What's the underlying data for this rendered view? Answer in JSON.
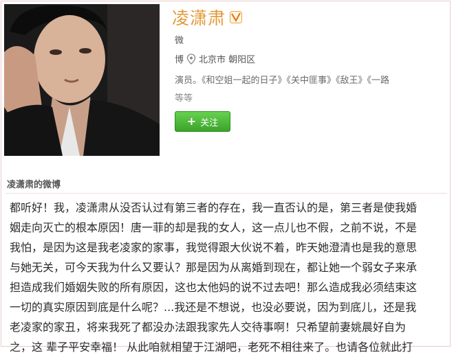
{
  "profile": {
    "name": "凌潇肃",
    "verified_icon": "v-verified-icon",
    "gender": "微",
    "location_label": "博",
    "location": "北京市 朝阳区",
    "tags_line1": "演员。《和空姐一起的日子》《关中匪事》《敌王》《一路",
    "tags_line2": "等等",
    "follow_label": "关注"
  },
  "feed": {
    "section_title": "凌潇肃的微博",
    "lines": [
      "都听好！我，凌潇肃从没否认过有第三者的存在，我一直否认的是，第三者是使我婚",
      "姻走向灭亡的根本原因！唐一菲的却是我的女人，这一点儿也不假，之前不说，不是",
      "我怕，是因为这是我老凌家的家事，我觉得跟大伙说不着，昨天她澄清也是我的意思",
      "与她无关，可今天我为什么又要认？那是因为从离婚到现在，都让她一个弱女子来承",
      "担造成我们婚姻失败的所有原因，这也太他妈的说不过去吧！那么造成我必须结束这",
      "一切的真实原因到底是什么呢？...我还是不想说，也没必要说，因为到底儿，还是我",
      "老凌家的家丑，将来我死了都没办法跟我家先人交待事啊！只希望前妻姚晨好自为",
      "之，这 辈子平安幸福！ 从此咱就相望于江湖吧，老死不相往来了。也请各位就此打"
    ]
  },
  "colors": {
    "name": "#e39a37",
    "follow_button": "#4cb83a",
    "border": "#e9c9c9"
  }
}
